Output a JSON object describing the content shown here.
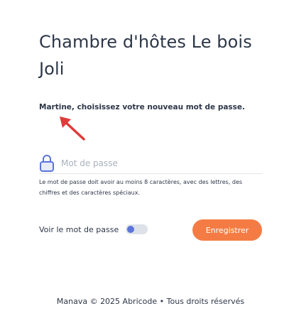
{
  "page": {
    "title": "Chambre d'hôtes Le bois Joli",
    "subtitle": "Martine, choisissez votre nouveau mot de passe."
  },
  "form": {
    "password_placeholder": "Mot de passe",
    "password_value": "",
    "hint": "Le mot de passe doit avoir au moins 8 caractères, avec des lettres, des chiffres et des caractères spéciaux.",
    "show_password_label": "Voir le mot de passe",
    "show_password_on": false,
    "save_label": "Enregistrer"
  },
  "footer": {
    "text": "Manava © 2025 Abricode • Tous droits réservés"
  },
  "icons": {
    "arrow": "arrow-pointer-icon",
    "lock": "lock-icon"
  },
  "colors": {
    "accent": "#f47c44",
    "toggle_knob": "#5b74d8",
    "arrow": "#e03a3a",
    "lock": "#5b74d8"
  }
}
